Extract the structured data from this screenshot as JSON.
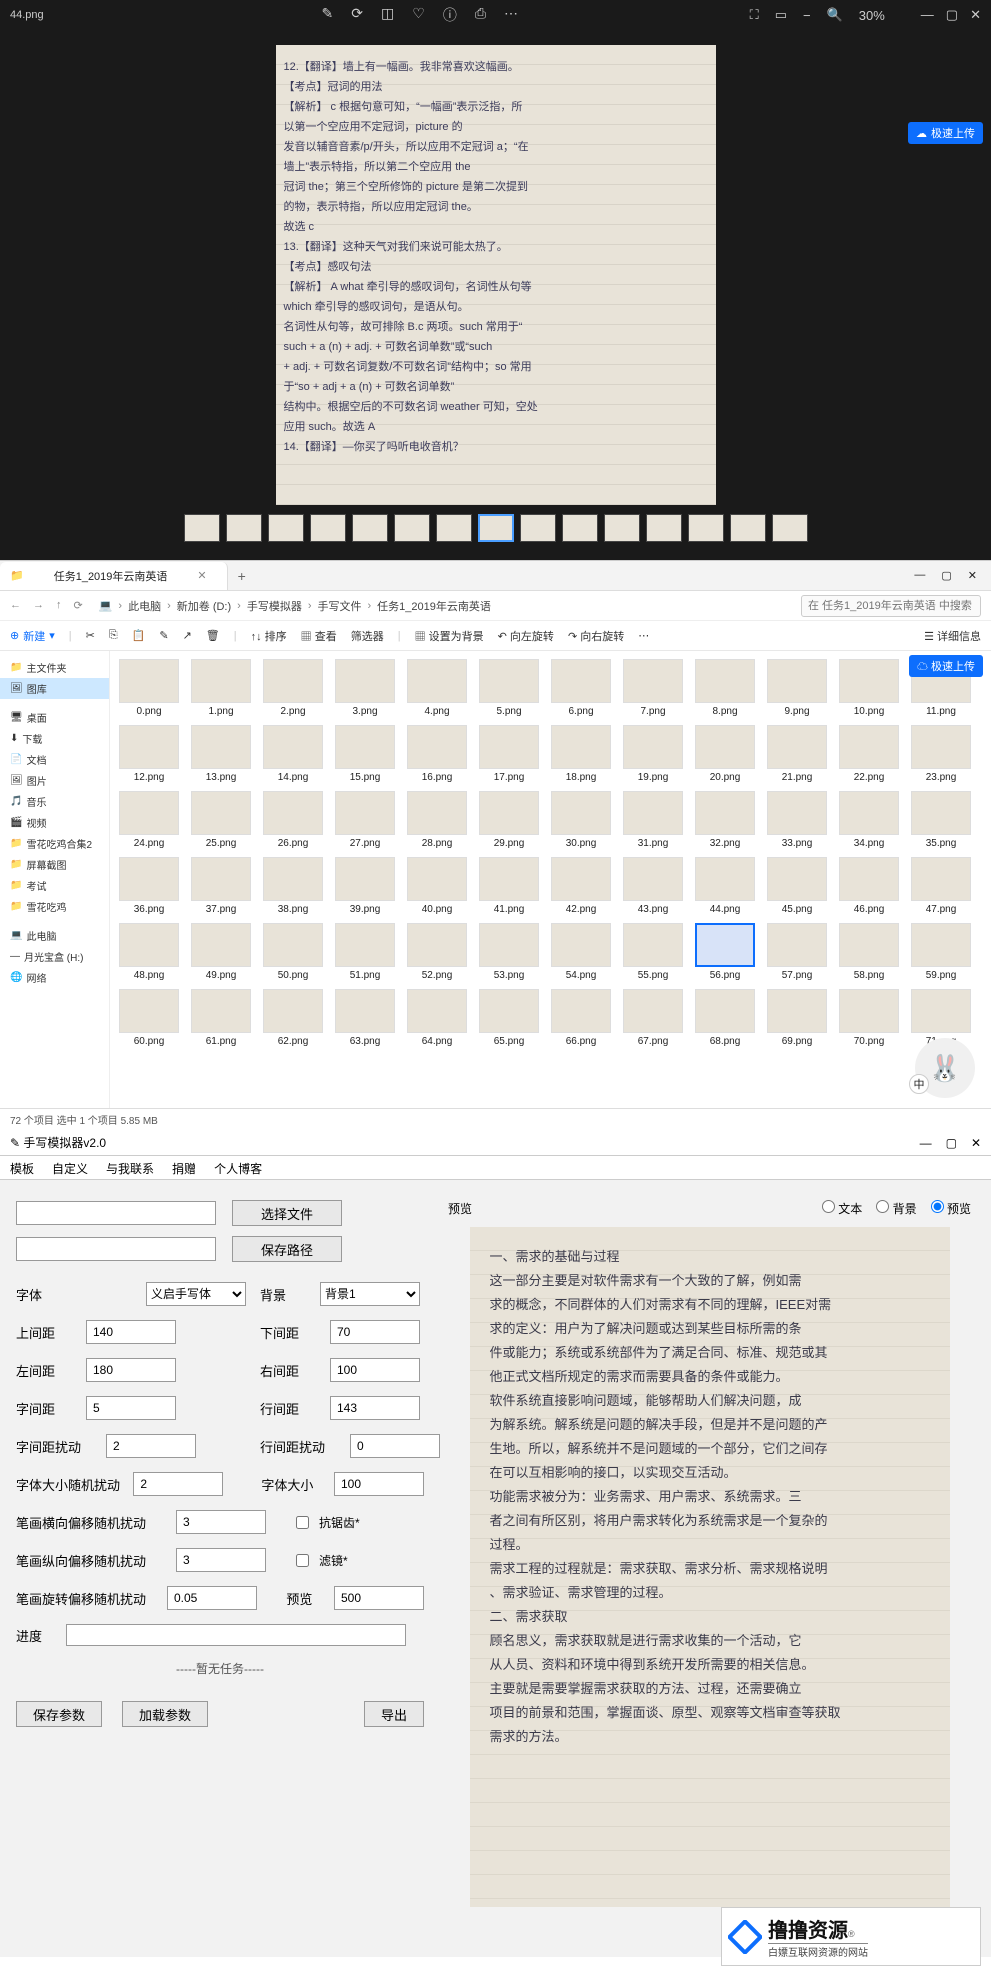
{
  "photos": {
    "title": "44.png",
    "center_icons": [
      "edit",
      "rotate",
      "crop",
      "heart",
      "info",
      "print",
      "more"
    ],
    "right": {
      "zoom": "30%",
      "fit": "⛶",
      "actual": "▭",
      "minus": "−",
      "plus": "Q"
    },
    "upload_label": "极速上传",
    "paper_lines": [
      "12.【翻译】墙上有一幅画。我非常喜欢这幅画。",
      "【考点】冠词的用法",
      "【解析】 c  根据句意可知，“一幅画”表示泛指，所",
      "以第一个空应用不定冠词，picture 的",
      "发音以辅音音素/p/开头，所以应用不定冠词 a；“在",
      "墙上”表示特指，所以第二个空应用 the",
      "冠词 the；第三个空所修饰的 picture 是第二次提到",
      "的物，表示特指，所以应用定冠词 the。",
      "故选 c",
      "13.【翻译】这种天气对我们来说可能太热了。",
      "【考点】感叹句法",
      "【解析】 A  what 牵引导的感叹词句，名词性从句等",
      "which 牵引导的感叹词句，是语从句。",
      "名词性从句等，故可排除 B.c 两项。such 常用于“",
      "such + a (n) + adj. + 可数名词单数”或“such",
      "+ adj. + 可数名词复数/不可数名词”结构中；so 常用",
      "于“so + adj + a (n) + 可数名词单数”",
      "结构中。根据空后的不可数名词 weather 可知，空处",
      "应用 such。故选 A",
      "14.【翻译】—你买了吗听电收音机？"
    ],
    "thumbs_count": 15,
    "selected_thumb": 7
  },
  "explorer": {
    "tab": "任务1_2019年云南英语",
    "crumbs": [
      "此电脑",
      "新加卷 (D:)",
      "手写模拟器",
      "手写文件",
      "任务1_2019年云南英语"
    ],
    "search_placeholder": "在 任务1_2019年云南英语 中搜索",
    "toolbar": {
      "new": "新建",
      "cut": "✂",
      "copy": "⎘",
      "paste": "📋",
      "rename": "✎",
      "share": "↗",
      "delete": "🗑",
      "sort": "↑↓ 排序",
      "view": "▦ 查看",
      "filter": "筛选器",
      "set_bg": "▦ 设置为背景",
      "rot_l": "↶ 向左旋转",
      "rot_r": "↷ 向右旋转",
      "details": "☰ 详细信息"
    },
    "sidebar": {
      "items": [
        {
          "icon": "📁",
          "label": "主文件夹"
        },
        {
          "icon": "🖼",
          "label": "图库",
          "selected": true
        },
        {
          "icon": "",
          "label": ""
        },
        {
          "icon": "🖥",
          "label": "桌面"
        },
        {
          "icon": "⬇",
          "label": "下载"
        },
        {
          "icon": "📄",
          "label": "文档"
        },
        {
          "icon": "🖼",
          "label": "图片"
        },
        {
          "icon": "🎵",
          "label": "音乐"
        },
        {
          "icon": "🎬",
          "label": "视频"
        },
        {
          "icon": "📁",
          "label": "雪花吃鸡合集2"
        },
        {
          "icon": "📁",
          "label": "屏幕截图"
        },
        {
          "icon": "📁",
          "label": "考试"
        },
        {
          "icon": "📁",
          "label": "雪花吃鸡"
        },
        {
          "icon": "",
          "label": ""
        },
        {
          "icon": "💻",
          "label": "此电脑"
        },
        {
          "icon": "—",
          "label": "月光宝盒 (H:)"
        },
        {
          "icon": "🌐",
          "label": "网络"
        }
      ]
    },
    "files_per_row": 12,
    "file_rows": 6,
    "file_prefix": "",
    "file_suffix": ".png",
    "selected_file": 56,
    "status": "72 个项目   选中 1 个项目  5.85 MB",
    "upload_label": "极速上传"
  },
  "app": {
    "title": "手写模拟器v2.0",
    "menu": [
      "模板",
      "自定义",
      "与我联系",
      "捐赠",
      "个人博客"
    ],
    "btn_select": "选择文件",
    "btn_savepath": "保存路径",
    "fields": {
      "font_lbl": "字体",
      "font_val": "义启手写体",
      "bg_lbl": "背景",
      "bg_val": "背景1",
      "top_lbl": "上间距",
      "top_val": "140",
      "bottom_lbl": "下间距",
      "bottom_val": "70",
      "left_lbl": "左间距",
      "left_val": "180",
      "right_lbl": "右间距",
      "right_val": "100",
      "charspc_lbl": "字间距",
      "charspc_val": "5",
      "linespc_lbl": "行间距",
      "linespc_val": "143",
      "charspc_j_lbl": "字间距扰动",
      "charspc_j_val": "2",
      "linespc_j_lbl": "行间距扰动",
      "linespc_j_val": "0",
      "size_j_lbl": "字体大小随机扰动",
      "size_j_val": "2",
      "size_lbl": "字体大小",
      "size_val": "100",
      "hoff_lbl": "笔画横向偏移随机扰动",
      "hoff_val": "3",
      "aa_lbl": "抗锯齿*",
      "voff_lbl": "笔画纵向偏移随机扰动",
      "voff_val": "3",
      "filter_lbl": "滤镜*",
      "rot_lbl": "笔画旋转偏移随机扰动",
      "rot_val": "0.05",
      "prev_lbl": "预览",
      "prev_val": "500",
      "progress_lbl": "进度",
      "tasks": "-----暂无任务-----",
      "save": "保存参数",
      "load": "加载参数",
      "export": "导出"
    },
    "preview": {
      "title": "预览",
      "opt_text": "文本",
      "opt_bg": "背景",
      "opt_prev": "预览",
      "lines": [
        "一、需求的基础与过程",
        "    这一部分主要是对软件需求有一个大致的了解，例如需",
        "求的概念，不同群体的人们对需求有不同的理解，IEEE对需",
        "求的定义：用户为了解决问题或达到某些目标所需的条",
        "件或能力；系统或系统部件为了满足合同、标准、规范或其",
        "他正式文档所规定的需求而需要具备的条件或能力。",
        "    软件系统直接影响问题域，能够帮助人们解决问题，成",
        "为解系统。解系统是问题的解决手段，但是并不是问题的产",
        "生地。所以，解系统并不是问题域的一个部分，它们之间存",
        "在可以互相影响的接口，以实现交互活动。",
        "    功能需求被分为：业务需求、用户需求、系统需求。三",
        "者之间有所区别，将用户需求转化为系统需求是一个复杂的",
        "过程。",
        "需求工程的过程就是：需求获取、需求分析、需求规格说明",
        "、需求验证、需求管理的过程。",
        "二、需求获取",
        "    顾名思义，需求获取就是进行需求收集的一个活动，它",
        "从人员、资料和环境中得到系统开发所需要的相关信息。",
        "    主要就是需要掌握需求获取的方法、过程，还需要确立",
        "项目的前景和范围，掌握面谈、原型、观察等文档审查等获取",
        "需求的方法。"
      ]
    }
  },
  "footer": {
    "big": "撸撸资源",
    "r": "®",
    "sub": "白嫖互联网资源的网站"
  }
}
